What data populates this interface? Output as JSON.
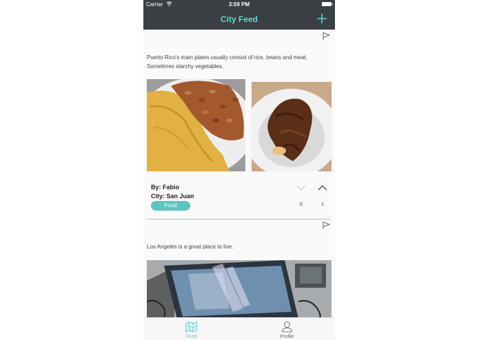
{
  "status_bar": {
    "carrier": "Carrier",
    "time": "3:59 PM"
  },
  "nav": {
    "title": "City Feed",
    "add_icon": "plus-icon"
  },
  "colors": {
    "accent": "#5bd6d0",
    "navbar": "#3a3f43",
    "tag": "#5bc5bf"
  },
  "posts": [
    {
      "description": "Puerto Rico's main plates usually consist of rice, beans and meat. Sometimes starchy vegetables.",
      "author": "By: Fabio",
      "city": "City: San Juan",
      "tag": "Food",
      "downvotes": "0",
      "upvotes": "1"
    },
    {
      "description": "Los Angeles is a great place to live."
    }
  ],
  "tabs": [
    {
      "label": "Feed",
      "icon": "map-icon",
      "active": true
    },
    {
      "label": "Profile",
      "icon": "person-icon",
      "active": false
    }
  ]
}
